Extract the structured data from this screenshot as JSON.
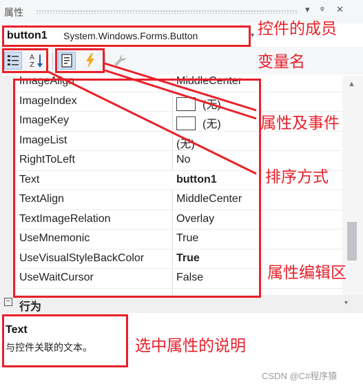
{
  "titlebar": {
    "title": "属性",
    "pin": "▾",
    "dock": "ᵠ",
    "close": "✕"
  },
  "selector": {
    "object_name": "button1",
    "object_type": "System.Windows.Forms.Button",
    "arrow": "▾"
  },
  "toolbar": {
    "categorized_icon": "categorized-icon",
    "alphabetical_icon": "alphabetical-icon",
    "properties_icon": "properties-icon",
    "events_icon": "events-lightning-icon",
    "property_pages_icon": "wrench-icon"
  },
  "properties": [
    {
      "name": "ImageAlign",
      "value": "MiddleCenter"
    },
    {
      "name": "ImageIndex",
      "value": "(无)",
      "swatch": true
    },
    {
      "name": "ImageKey",
      "value": "(无)",
      "swatch": true
    },
    {
      "name": "ImageList",
      "value": "(无)"
    },
    {
      "name": "RightToLeft",
      "value": "No"
    },
    {
      "name": "Text",
      "value": "button1",
      "bold": true
    },
    {
      "name": "TextAlign",
      "value": "MiddleCenter"
    },
    {
      "name": "TextImageRelation",
      "value": "Overlay"
    },
    {
      "name": "UseMnemonic",
      "value": "True"
    },
    {
      "name": "UseVisualStyleBackColor",
      "value": "True",
      "bold": true
    },
    {
      "name": "UseWaitCursor",
      "value": "False"
    }
  ],
  "category": {
    "toggle": "−",
    "label": "行为",
    "arrow": "▾"
  },
  "description": {
    "title": "Text",
    "text": "与控件关联的文本。"
  },
  "watermark": "CSDN @C#程序猿",
  "annotations": {
    "member_var": "控件的成员",
    "member_var2": "变量名",
    "props_events": "属性及事件",
    "sort_mode": "排序方式",
    "edit_area": "属性编辑区",
    "desc_area": "选中属性的说明"
  },
  "colors": {
    "annotation": "#e8202a",
    "toolbar_bg": "#f5f6f7",
    "active_tool": "#cfe0f3"
  }
}
